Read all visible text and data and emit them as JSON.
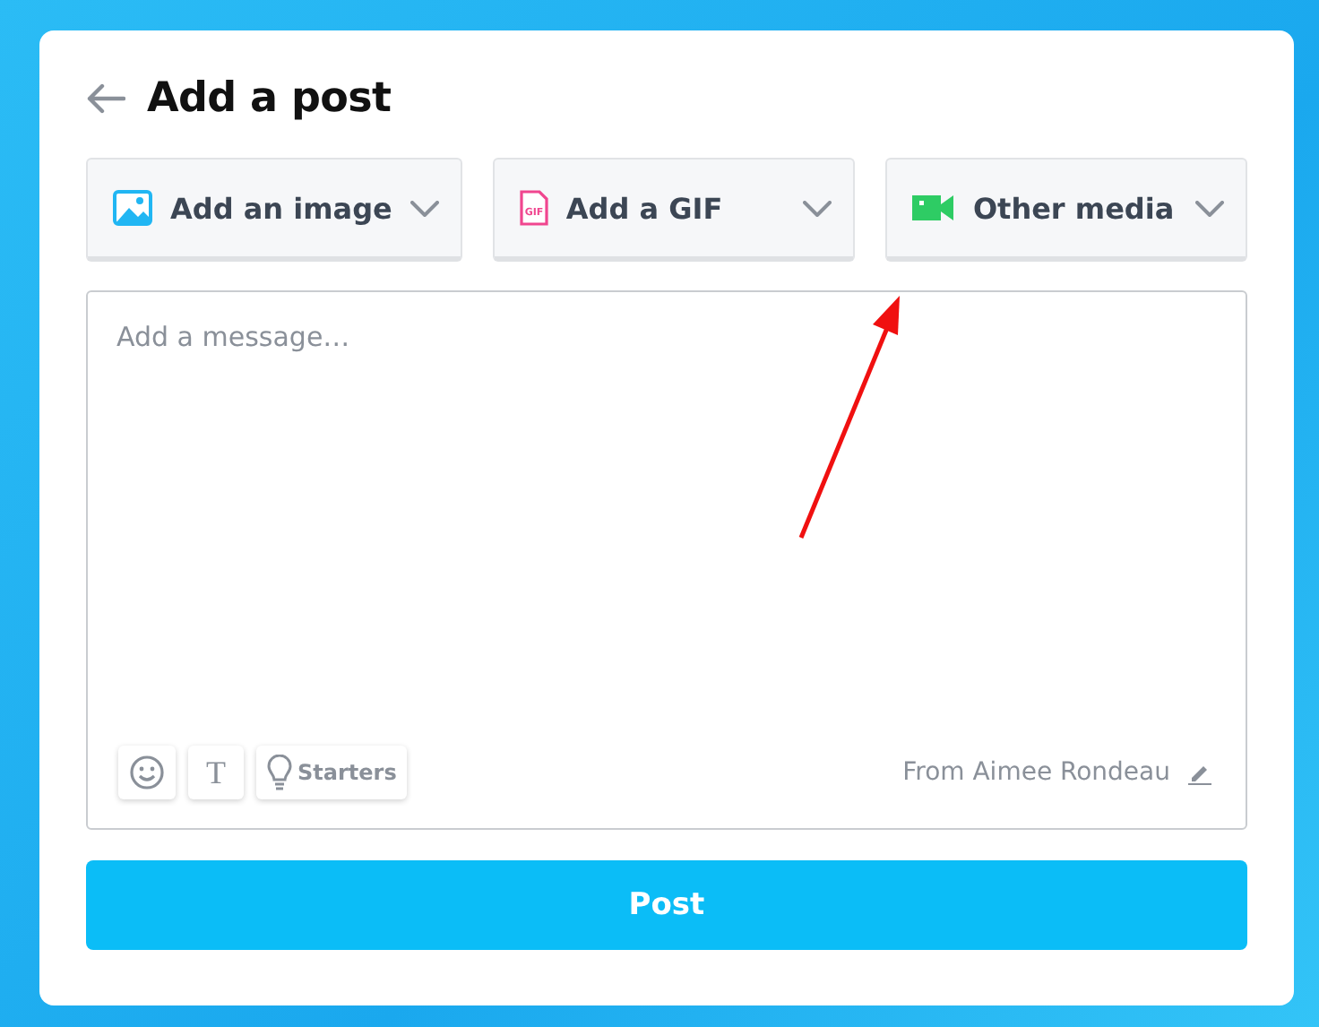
{
  "header": {
    "title": "Add a post"
  },
  "media_buttons": [
    {
      "kind": "image",
      "label": "Add an image"
    },
    {
      "kind": "gif",
      "label": "Add a GIF",
      "icon_text": "GIF"
    },
    {
      "kind": "video",
      "label": "Other media"
    }
  ],
  "message": {
    "placeholder": "Add a message…"
  },
  "toolbar": {
    "text_icon": "T",
    "starters_label": "Starters"
  },
  "author": "From Aimee Rondeau",
  "post_button": "Post"
}
